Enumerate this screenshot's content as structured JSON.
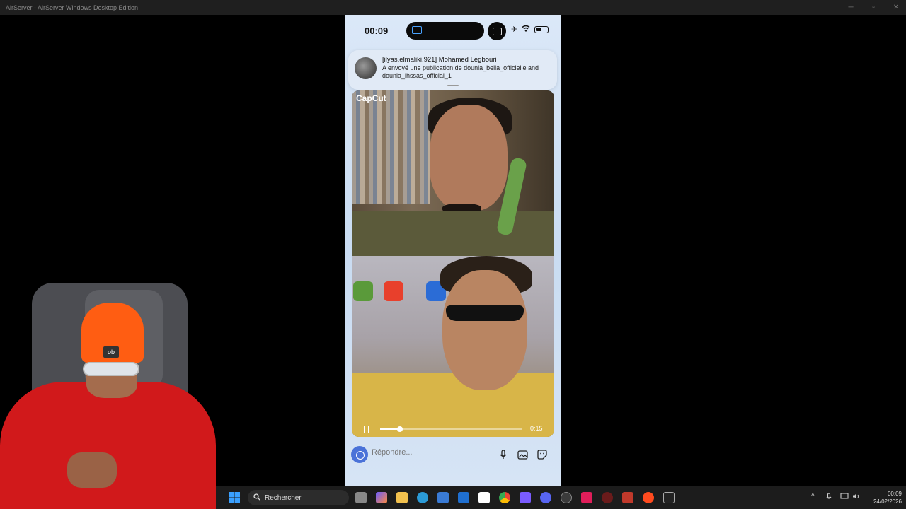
{
  "window": {
    "title": "AirServer - AirServer Windows Desktop Edition"
  },
  "phone": {
    "status_time": "00:09",
    "notification": {
      "title": "[ilyas.elmaliki.921] Mohamed Legbouri",
      "body": "A envoyé une publication de dounia_bella_officielle and dounia_ihssas_official_1"
    },
    "video": {
      "watermark": "CapCut",
      "elapsed": "0:15",
      "progress_fraction": 0.14
    },
    "reply": {
      "placeholder": "Répondre..."
    }
  },
  "webcam": {
    "beanie_logo": "ob"
  },
  "taskbar": {
    "search_label": "Rechercher",
    "time": "00:09",
    "date": "24/02/2026"
  },
  "colors": {
    "accent": "#4a72d8",
    "titlebar": "#1f1f1f",
    "taskbar": "#1c1c1c"
  }
}
